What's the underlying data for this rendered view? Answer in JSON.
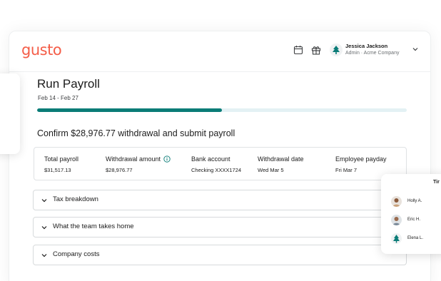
{
  "brand": {
    "logo_text": "gusto",
    "color": "#f45d48"
  },
  "header": {
    "icons": [
      "calendar-icon",
      "gift-icon"
    ],
    "user": {
      "name": "Jessica Jackson",
      "subtitle": "Admin · Acme Company"
    }
  },
  "payroll": {
    "title": "Run Payroll",
    "date_range": "Feb 14 - Feb 27",
    "progress_percent": 50,
    "progress_color": "#0a7c77",
    "confirm_heading": "Confirm $28,976.77 withdrawal and submit payroll",
    "summary": [
      {
        "label": "Total payroll",
        "value": "$31,517.13"
      },
      {
        "label": "Withdrawal amount",
        "value": "$28,976.77",
        "icon": "info-icon"
      },
      {
        "label": "Bank account",
        "value": "Checking XXXX1724"
      },
      {
        "label": "Withdrawal date",
        "value": "Wed Mar 5"
      },
      {
        "label": "Employee payday",
        "value": "Fri Mar 7"
      }
    ],
    "accordions": [
      {
        "label": "Tax breakdown"
      },
      {
        "label": "What the team takes home"
      },
      {
        "label": "Company costs"
      }
    ]
  },
  "team_card": {
    "header": "Tir",
    "members": [
      {
        "name": "Holly A."
      },
      {
        "name": "Eric H."
      },
      {
        "name": "Elena L."
      }
    ]
  }
}
